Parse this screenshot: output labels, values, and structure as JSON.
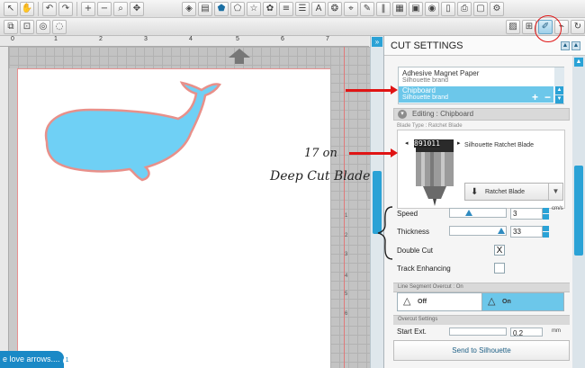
{
  "toolbar_top": {
    "left_group": [
      "cursor-icon",
      "hand-icon",
      "undo-icon",
      "redo-icon",
      "zoom-in-icon",
      "zoom-out-icon",
      "zoom-select-icon",
      "fit-icon"
    ],
    "right_group": [
      "replicate-icon",
      "fill-icon",
      "pentagon-icon",
      "shape-icon",
      "star-icon",
      "flower-icon",
      "lines-icon",
      "align-icon",
      "text-icon",
      "trace-icon",
      "knife-icon",
      "edit-icon",
      "barcode-icon",
      "offset-icon",
      "layout-icon",
      "store-icon",
      "library-icon",
      "send-icon",
      "sheet-icon",
      "settings-icon"
    ]
  },
  "toolbar_second": {
    "left_group": [
      "group-icon",
      "ungroup-icon",
      "compound-icon",
      "release-icon"
    ],
    "right_group": [
      "design-page-icon",
      "registration-icon",
      "cut-settings-icon",
      "trace-panel-icon",
      "refresh-icon"
    ]
  },
  "canvas": {
    "ruler_numbers": [
      "0",
      "1",
      "2",
      "3",
      "4",
      "5",
      "6",
      "7"
    ],
    "ruler_left_numbers": [
      "1",
      "2",
      "3",
      "4",
      "5",
      "6"
    ],
    "shape_fill": "#6fd0f5",
    "shape_stroke": "#e8908a",
    "status_tab": "e love arrows....",
    "status_badge": "1"
  },
  "annotation": {
    "line1": "17 on",
    "line2": "Deep Cut Blade"
  },
  "panel": {
    "title": "CUT SETTINGS",
    "materials": [
      {
        "name": "Adhesive Magnet Paper",
        "brand": "Silhouette brand"
      },
      {
        "name": "Chipboard",
        "brand": "Silhouette brand",
        "selected": true
      }
    ],
    "add_label": "+",
    "remove_label": "−",
    "editing_label": "Editing : Chipboard",
    "blade_type_label": "Blade Type : Ratchet Blade",
    "blade_name": "Silhouette Ratchet Blade",
    "blade_dial": "891011",
    "blade_select_label": "Ratchet Blade",
    "speed": {
      "label": "Speed",
      "value": "3",
      "unit": "cm/s",
      "fraction": 0.3
    },
    "thickness": {
      "label": "Thickness",
      "value": "33",
      "fraction": 0.95
    },
    "double_cut": {
      "label": "Double Cut",
      "checked": true,
      "mark": "X"
    },
    "track_enhancing": {
      "label": "Track Enhancing",
      "checked": false
    },
    "line_segment_label": "Line Segment Overcut : On",
    "overcut_off": "Off",
    "overcut_on": "On",
    "overcut_settings_label": "Overcut Settings",
    "start_ext_label": "Start Ext.",
    "start_ext_value": "0.2",
    "start_ext_unit": "mm",
    "send_button": "Send to Silhouette"
  },
  "colors": {
    "accent": "#2aa2d6",
    "selected": "#6cc7ea",
    "annotation_red": "#e01414"
  }
}
